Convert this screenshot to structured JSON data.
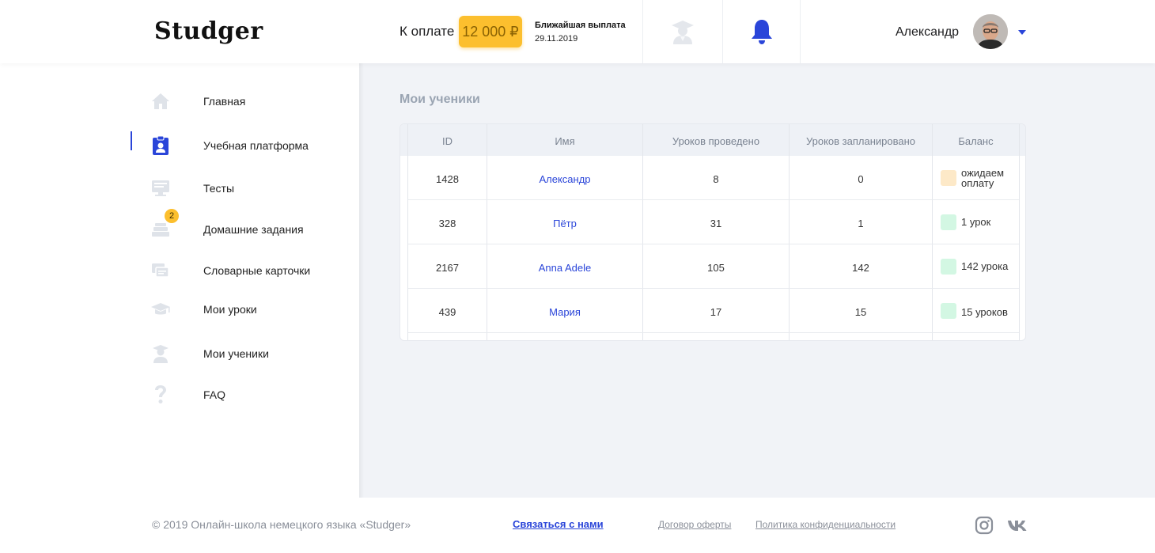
{
  "header": {
    "logo": "Studger",
    "pay_label": "К оплате",
    "pay_amount": "12 000 ₽",
    "payout_title": "Ближайшая выплата",
    "payout_date": "29.11.2019",
    "user_name": "Александр"
  },
  "sidebar": {
    "items": [
      {
        "label": "Главная",
        "icon": "home-icon"
      },
      {
        "label": "Учебная платформа",
        "icon": "clipboard-user-icon",
        "active": true
      },
      {
        "label": "Тесты",
        "icon": "monitor-icon"
      },
      {
        "label": "Домашние задания",
        "icon": "books-icon",
        "badge": "2"
      },
      {
        "label": "Словарные карточки",
        "icon": "cards-icon"
      },
      {
        "label": "Мои уроки",
        "icon": "graduation-cap-icon"
      },
      {
        "label": "Мои ученики",
        "icon": "student-icon"
      },
      {
        "label": "FAQ",
        "icon": "question-icon"
      }
    ]
  },
  "main": {
    "title": "Мои ученики",
    "table": {
      "headers": [
        "ID",
        "Имя",
        "Уроков проведено",
        "Уроков запланировано",
        "Баланс"
      ],
      "rows": [
        {
          "id": "1428",
          "name": "Александр",
          "done": "8",
          "planned": "0",
          "balance_1": "ожидаем",
          "balance_2": "оплату",
          "status": "pending"
        },
        {
          "id": "328",
          "name": "Пётр",
          "done": "31",
          "planned": "1",
          "balance_1": "1 урок",
          "balance_2": "",
          "status": "ok"
        },
        {
          "id": "2167",
          "name": "Anna Adele",
          "done": "105",
          "planned": "142",
          "balance_1": "142 урока",
          "balance_2": "",
          "status": "ok"
        },
        {
          "id": "439",
          "name": "Мария",
          "done": "17",
          "planned": "15",
          "balance_1": "15 уроков",
          "balance_2": "",
          "status": "ok"
        }
      ]
    }
  },
  "footer": {
    "copyright": "© 2019 Онлайн-школа немецкого языка «Studger»",
    "contact": "Связаться с нами",
    "offer": "Договор оферты",
    "privacy": "Политика конфиденциальности"
  },
  "colors": {
    "accent": "#2a45d9",
    "pay_badge": "#fcbf2e",
    "balance_pending": "#fde9c8",
    "balance_ok": "#d3f7e3"
  }
}
